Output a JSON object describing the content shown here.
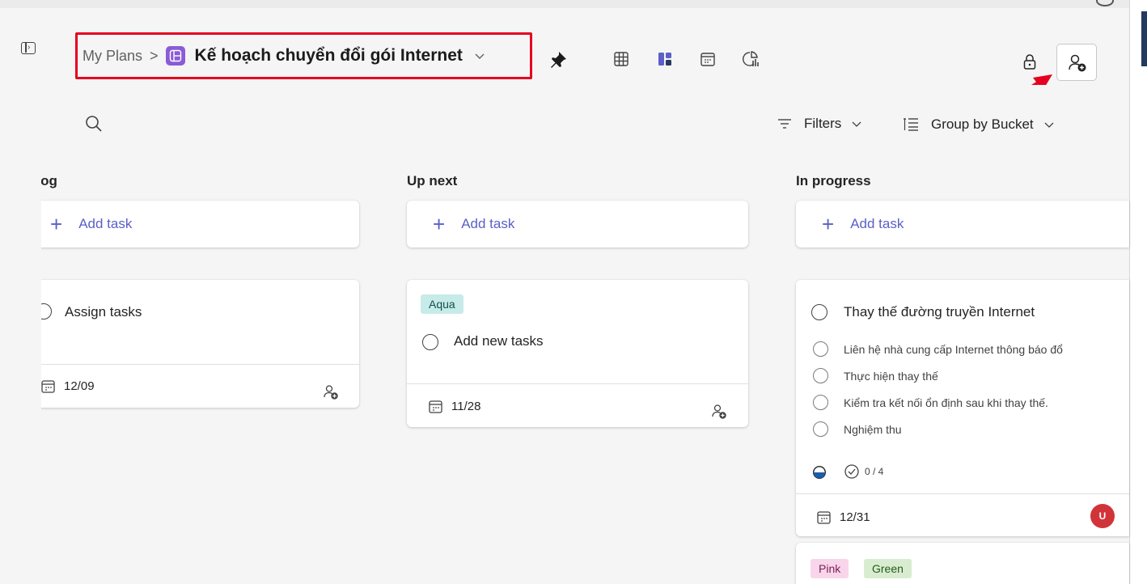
{
  "header": {
    "breadcrumb_root": "My Plans",
    "breadcrumb_sep": ">",
    "plan_title": "Kế hoạch chuyển đổi gói Internet",
    "active_view": "board",
    "views": [
      "grid-view",
      "board-view",
      "schedule-view",
      "charts-view"
    ]
  },
  "toolbar": {
    "filters_label": "Filters",
    "group_by_label": "Group by Bucket"
  },
  "columns": [
    {
      "title": "klog",
      "add_task_label": "Add task",
      "cards": [
        {
          "title": "Assign tasks",
          "due": "12/09"
        }
      ]
    },
    {
      "title": "Up next",
      "add_task_label": "Add task",
      "cards": [
        {
          "labels": [
            "Aqua"
          ],
          "title": "Add new tasks",
          "due": "11/28"
        }
      ]
    },
    {
      "title": "In progress",
      "add_task_label": "Add task",
      "cards": [
        {
          "title": "Thay thế đường truyền Internet",
          "checklist": [
            "Liên hệ nhà cung cấp Internet thông báo đổ",
            "Thực hiện thay thế",
            "Kiểm tra kết nối ổn định sau khi thay thế.",
            "Nghiệm thu"
          ],
          "checklist_progress": "0 / 4",
          "due": "12/31",
          "assignee_initial": "U"
        },
        {
          "labels": [
            "Pink",
            "Green"
          ]
        }
      ]
    }
  ],
  "colors": {
    "accent": "#5b5fc7",
    "highlight_box": "#e5001f",
    "plan_icon": "#8a5cd6",
    "avatar": "#d13438"
  }
}
